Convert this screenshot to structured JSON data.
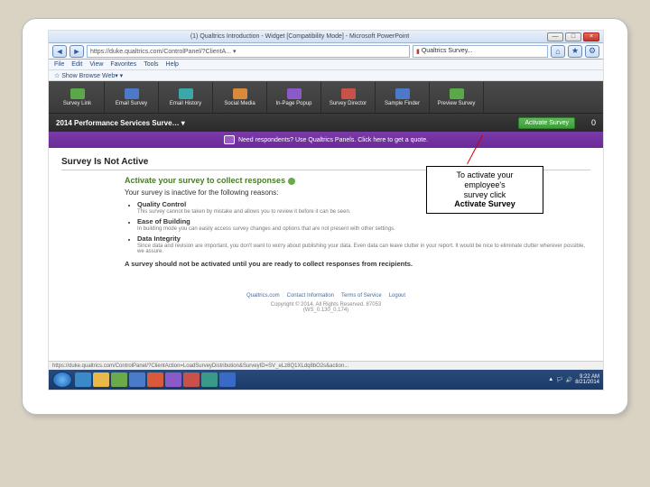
{
  "window": {
    "title": "(1) Qualtrics Introduction - Widget [Compatibility Mode] - Microsoft PowerPoint"
  },
  "browser": {
    "url": "https://duke.qualtrics.com/ControlPanel/?ClientA... ▾",
    "tab": "Qualtrics Survey...",
    "menu": [
      "File",
      "Edit",
      "View",
      "Favorites",
      "Tools",
      "Help"
    ],
    "fav": "☆ Show Browse Web▾ ▾"
  },
  "toolbar": [
    {
      "label": "Survey Link",
      "color": "green"
    },
    {
      "label": "Email Survey",
      "color": "blue"
    },
    {
      "label": "Email History",
      "color": "teal"
    },
    {
      "label": "Social Media",
      "color": "orange"
    },
    {
      "label": "In-Page Popup",
      "color": "purple"
    },
    {
      "label": "Survey Director",
      "color": "red"
    },
    {
      "label": "Sample Finder",
      "color": "blue"
    },
    {
      "label": "Preview Survey",
      "color": "green"
    }
  ],
  "surveybar": {
    "title": "2014 Performance Services Surve… ▾",
    "activate": "Activate Survey",
    "count": "0"
  },
  "purplebar": {
    "text": "Need respondents? Use Qualtrics Panels. Click here to get a quote."
  },
  "content": {
    "heading": "Survey Is Not Active",
    "activate_title": "Activate your survey to collect responses",
    "reason_intro": "Your survey is inactive for the following reasons:",
    "reasons": [
      {
        "title": "Quality Control",
        "sub": "This survey cannot be taken by mistake and allows you to review it before it can be seen."
      },
      {
        "title": "Ease of Building",
        "sub": "In building mode you can easily access survey changes and options that are not present with other settings."
      },
      {
        "title": "Data Integrity",
        "sub": "Since data and revision are important, you don't want to worry about publishing your data. Even data can leave clutter in your report. It would be nice to eliminate clutter wherever possible, we assure."
      }
    ],
    "warning": "A survey should not be activated until you are ready to collect responses from recipients."
  },
  "callout": {
    "line1": "To activate your",
    "line2": "employee's",
    "line3": "survey click",
    "line4": "Activate Survey"
  },
  "footer": {
    "links": [
      "Qualtrics.com",
      "Contact Information",
      "Terms of Service",
      "Logout"
    ],
    "copyright": "Copyright © 2014. All Rights Reserved. 87053",
    "ip": "(WS_0.130_0.174)"
  },
  "statusbar": "https://duke.qualtrics.com/ControlPanel/?ClientAction=LoadSurveyDistribution&SurveyID=SV_eLz8Q1XLdq8bO2s&action...",
  "tray": {
    "time": "9:22 AM",
    "date": "8/21/2014"
  },
  "taskicons": [
    "#3a8ac8",
    "#e8b848",
    "#6aaa4a",
    "#4a7ac8",
    "#d85a3a",
    "#8a5ac8",
    "#c8524a",
    "#3a9a8a",
    "#3a6ac8"
  ]
}
